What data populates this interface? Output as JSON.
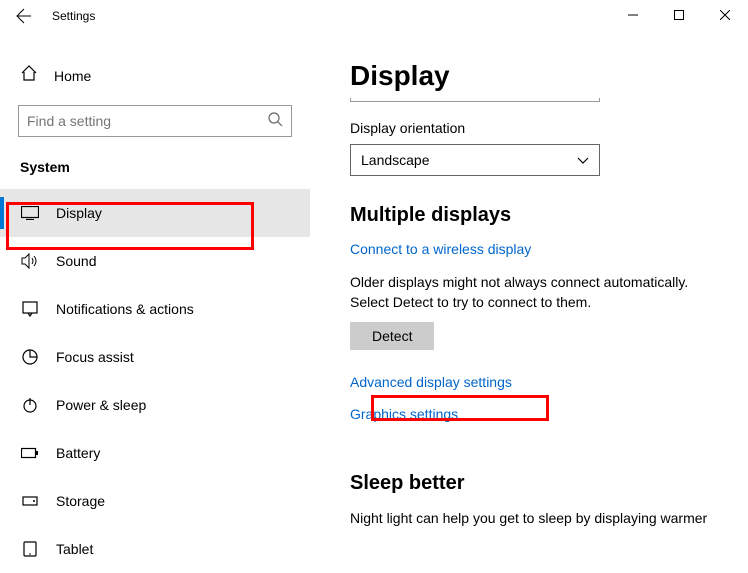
{
  "titlebar": {
    "title": "Settings"
  },
  "sidebar": {
    "home": "Home",
    "search_placeholder": "Find a setting",
    "category": "System",
    "items": [
      {
        "label": "Display"
      },
      {
        "label": "Sound"
      },
      {
        "label": "Notifications & actions"
      },
      {
        "label": "Focus assist"
      },
      {
        "label": "Power & sleep"
      },
      {
        "label": "Battery"
      },
      {
        "label": "Storage"
      },
      {
        "label": "Tablet"
      }
    ]
  },
  "content": {
    "page_title": "Display",
    "orientation_label": "Display orientation",
    "orientation_value": "Landscape",
    "multiple_displays_heading": "Multiple displays",
    "wireless_link": "Connect to a wireless display",
    "detect_text": "Older displays might not always connect automatically. Select Detect to try to connect to them.",
    "detect_btn": "Detect",
    "advanced_link": "Advanced display settings",
    "graphics_link": "Graphics settings",
    "sleep_heading": "Sleep better",
    "sleep_text": "Night light can help you get to sleep by displaying warmer"
  }
}
